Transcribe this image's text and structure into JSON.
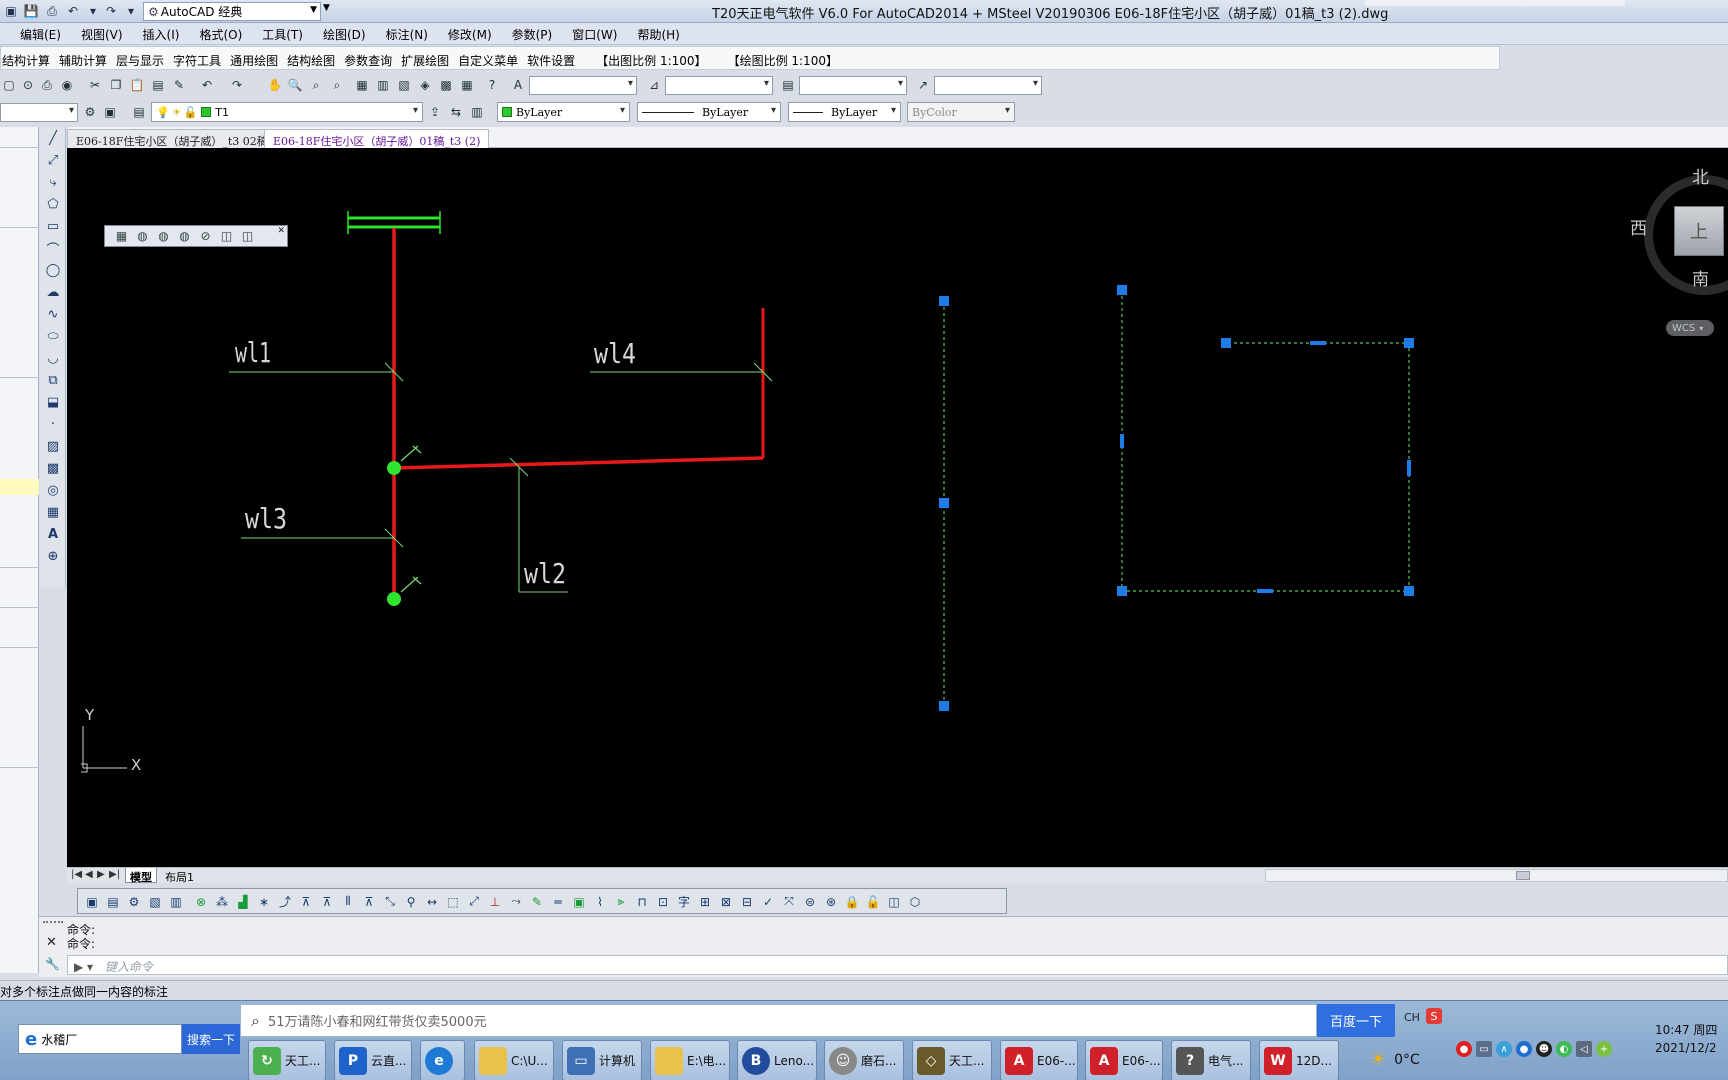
{
  "app": {
    "window_title": "T20天正电气软件 V6.0 For AutoCAD2014 + MSteel V20190306    E06-18F住宅小区（胡子威）01稿_t3 (2).dwg",
    "workspace": "AutoCAD 经典"
  },
  "menu": [
    "编辑(E)",
    "视图(V)",
    "插入(I)",
    "格式(O)",
    "工具(T)",
    "绘图(D)",
    "标注(N)",
    "修改(M)",
    "参数(P)",
    "窗口(W)",
    "帮助(H)"
  ],
  "t20_menu": [
    "结构计算",
    "辅助计算",
    "层与显示",
    "字符工具",
    "通用绘图",
    "结构绘图",
    "参数查询",
    "扩展绘图",
    "自定义菜单",
    "软件设置"
  ],
  "t20_scales": {
    "out_scale": "【出图比例 1:100】",
    "draw_scale": "【绘图比例 1:100】"
  },
  "layer": {
    "current": "T1"
  },
  "properties": {
    "color": "ByLayer",
    "linetype": "ByLayer",
    "lineweight": "ByLayer",
    "plotstyle": "ByColor"
  },
  "doc_tabs": [
    {
      "label": "E06-18F住宅小区（胡子威）_t3 02稿",
      "active": false
    },
    {
      "label": "E06-18F住宅小区（胡子威）01稿_t3 (2)",
      "active": true
    }
  ],
  "drawing": {
    "labels": [
      "wl1",
      "wl4",
      "wl3",
      "wl2"
    ],
    "colors": {
      "main_line": "#e8191b",
      "leader": "#79d879",
      "node": "#2ee42e",
      "grip": "#1e7ce6",
      "selection": "#5fbf5f"
    }
  },
  "viewcube": {
    "north": "北",
    "south": "南",
    "west": "西",
    "face": "上",
    "wcs": "WCS"
  },
  "ucs": {
    "x": "X",
    "y": "Y"
  },
  "layout_tabs": [
    {
      "label": "模型",
      "active": true
    },
    {
      "label": "布局1",
      "active": false
    }
  ],
  "command": {
    "history": [
      "命令:",
      "命令:"
    ],
    "placeholder": "键入命令"
  },
  "status_text": "对多个标注点做同一内容的标注",
  "taskbar": {
    "ie_address": "水稽厂",
    "ie_search": "搜索一下",
    "baidu_placeholder": "51万请陈小春和网红带货仅卖5000元",
    "baidu_button": "百度一下",
    "items": [
      {
        "label": "天工...",
        "icon": "tiangong-icon",
        "color": "#4caf50"
      },
      {
        "label": "云直...",
        "icon": "pdf-icon",
        "color": "#1e63c9"
      },
      {
        "label": "",
        "icon": "ie-icon",
        "color": "#1f7ad6"
      },
      {
        "label": "C:\\U...",
        "icon": "folder-icon",
        "color": "#e8c24a"
      },
      {
        "label": "计算机",
        "icon": "computer-icon",
        "color": "#3f6fb5"
      },
      {
        "label": "E:\\电...",
        "icon": "folder-icon",
        "color": "#e8c24a"
      },
      {
        "label": "Leno...",
        "icon": "lenovo-icon",
        "color": "#234c9c"
      },
      {
        "label": "磨石...",
        "icon": "avatar-icon",
        "color": "#888888"
      },
      {
        "label": "天工...",
        "icon": "tiangong-cube-icon",
        "color": "#6a5a2a"
      },
      {
        "label": "E06-...",
        "icon": "autocad-icon",
        "color": "#d0202a"
      },
      {
        "label": "E06-...",
        "icon": "autocad-icon",
        "color": "#d0202a"
      },
      {
        "label": "电气...",
        "icon": "help-icon",
        "color": "#555555"
      },
      {
        "label": "12D...",
        "icon": "wps-icon",
        "color": "#d0202a"
      }
    ],
    "tray_lang": "CH",
    "weather": "0°C",
    "clock_time": "10:47 周四",
    "clock_date": "2021/12/2"
  }
}
